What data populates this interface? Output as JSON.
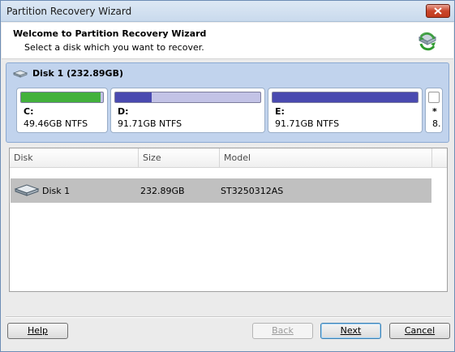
{
  "window": {
    "title": "Partition Recovery Wizard"
  },
  "header": {
    "title": "Welcome to Partition Recovery Wizard",
    "subtitle": "Select a disk which you want to recover.",
    "icon": "recover-disk-icon"
  },
  "disk_map": {
    "label": "Disk 1 (232.89GB)",
    "partitions": [
      {
        "letter": "C:",
        "info": "49.46GB NTFS",
        "used_fraction": 0.97,
        "color": "#43b13c"
      },
      {
        "letter": "D:",
        "info": "91.71GB NTFS",
        "used_fraction": 0.25,
        "color": "#4a4ab0"
      },
      {
        "letter": "E:",
        "info": "91.71GB NTFS",
        "used_fraction": 1.0,
        "color": "#4a4ab0"
      },
      {
        "letter": "*",
        "info": "8.",
        "used_fraction": 0,
        "color": "#ffffff"
      }
    ]
  },
  "list": {
    "columns": [
      "Disk",
      "Size",
      "Model"
    ],
    "rows": [
      {
        "disk": "Disk 1",
        "size": "232.89GB",
        "model": "ST3250312AS"
      }
    ]
  },
  "buttons": {
    "help": "Help",
    "back": "Back",
    "next": "Next",
    "cancel": "Cancel"
  }
}
